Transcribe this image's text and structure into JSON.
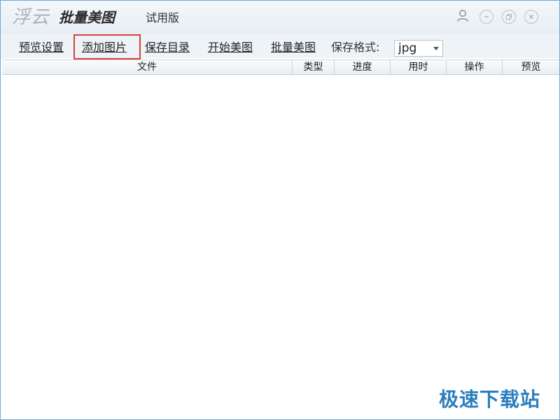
{
  "titlebar": {
    "brand_script": "浮云",
    "brand_name": "批量美图",
    "edition": "试用版"
  },
  "menu": {
    "items": [
      {
        "label": "预览设置"
      },
      {
        "label": "添加图片"
      },
      {
        "label": "保存目录"
      },
      {
        "label": "开始美图"
      },
      {
        "label": "批量美图"
      }
    ],
    "format_label": "保存格式:",
    "format_value": "jpg"
  },
  "grid": {
    "columns": [
      "文件",
      "类型",
      "进度",
      "用时",
      "操作",
      "预览"
    ],
    "rows": []
  },
  "watermark": "极速下载站",
  "colors": {
    "highlight": "#d9403d",
    "watermark": "#2a7fbf",
    "window_border": "#6fa9d8"
  },
  "icons": [
    "user-icon",
    "minimize-icon",
    "maximize-icon",
    "close-icon",
    "dropdown-arrow-icon"
  ]
}
